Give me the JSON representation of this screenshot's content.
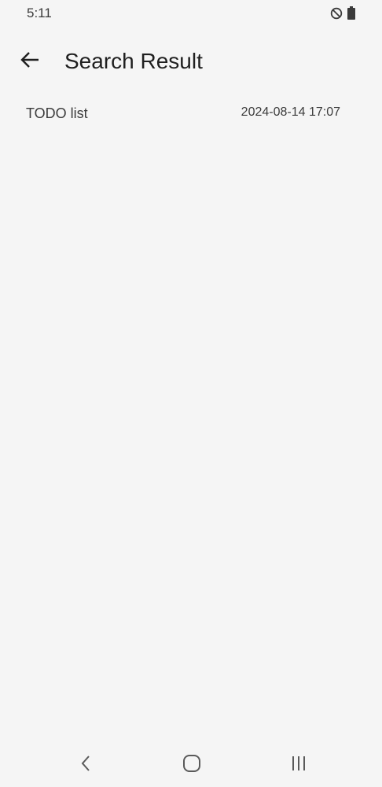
{
  "status_bar": {
    "time": "5:11",
    "icons": [
      "do-not-disturb-icon",
      "battery-icon"
    ]
  },
  "app_bar": {
    "back_icon": "arrow-left-icon",
    "title": "Search Result"
  },
  "results": [
    {
      "title": "TODO list",
      "date": "2024-08-14 17:07"
    }
  ],
  "nav_bar": {
    "icons": [
      "nav-back-icon",
      "nav-home-icon",
      "nav-recents-icon"
    ]
  },
  "colors": {
    "background": "#f5f5f5",
    "text": "#1f1f1f",
    "secondary_text": "#3c3c3c",
    "nav_icon": "#5a5a5a"
  }
}
